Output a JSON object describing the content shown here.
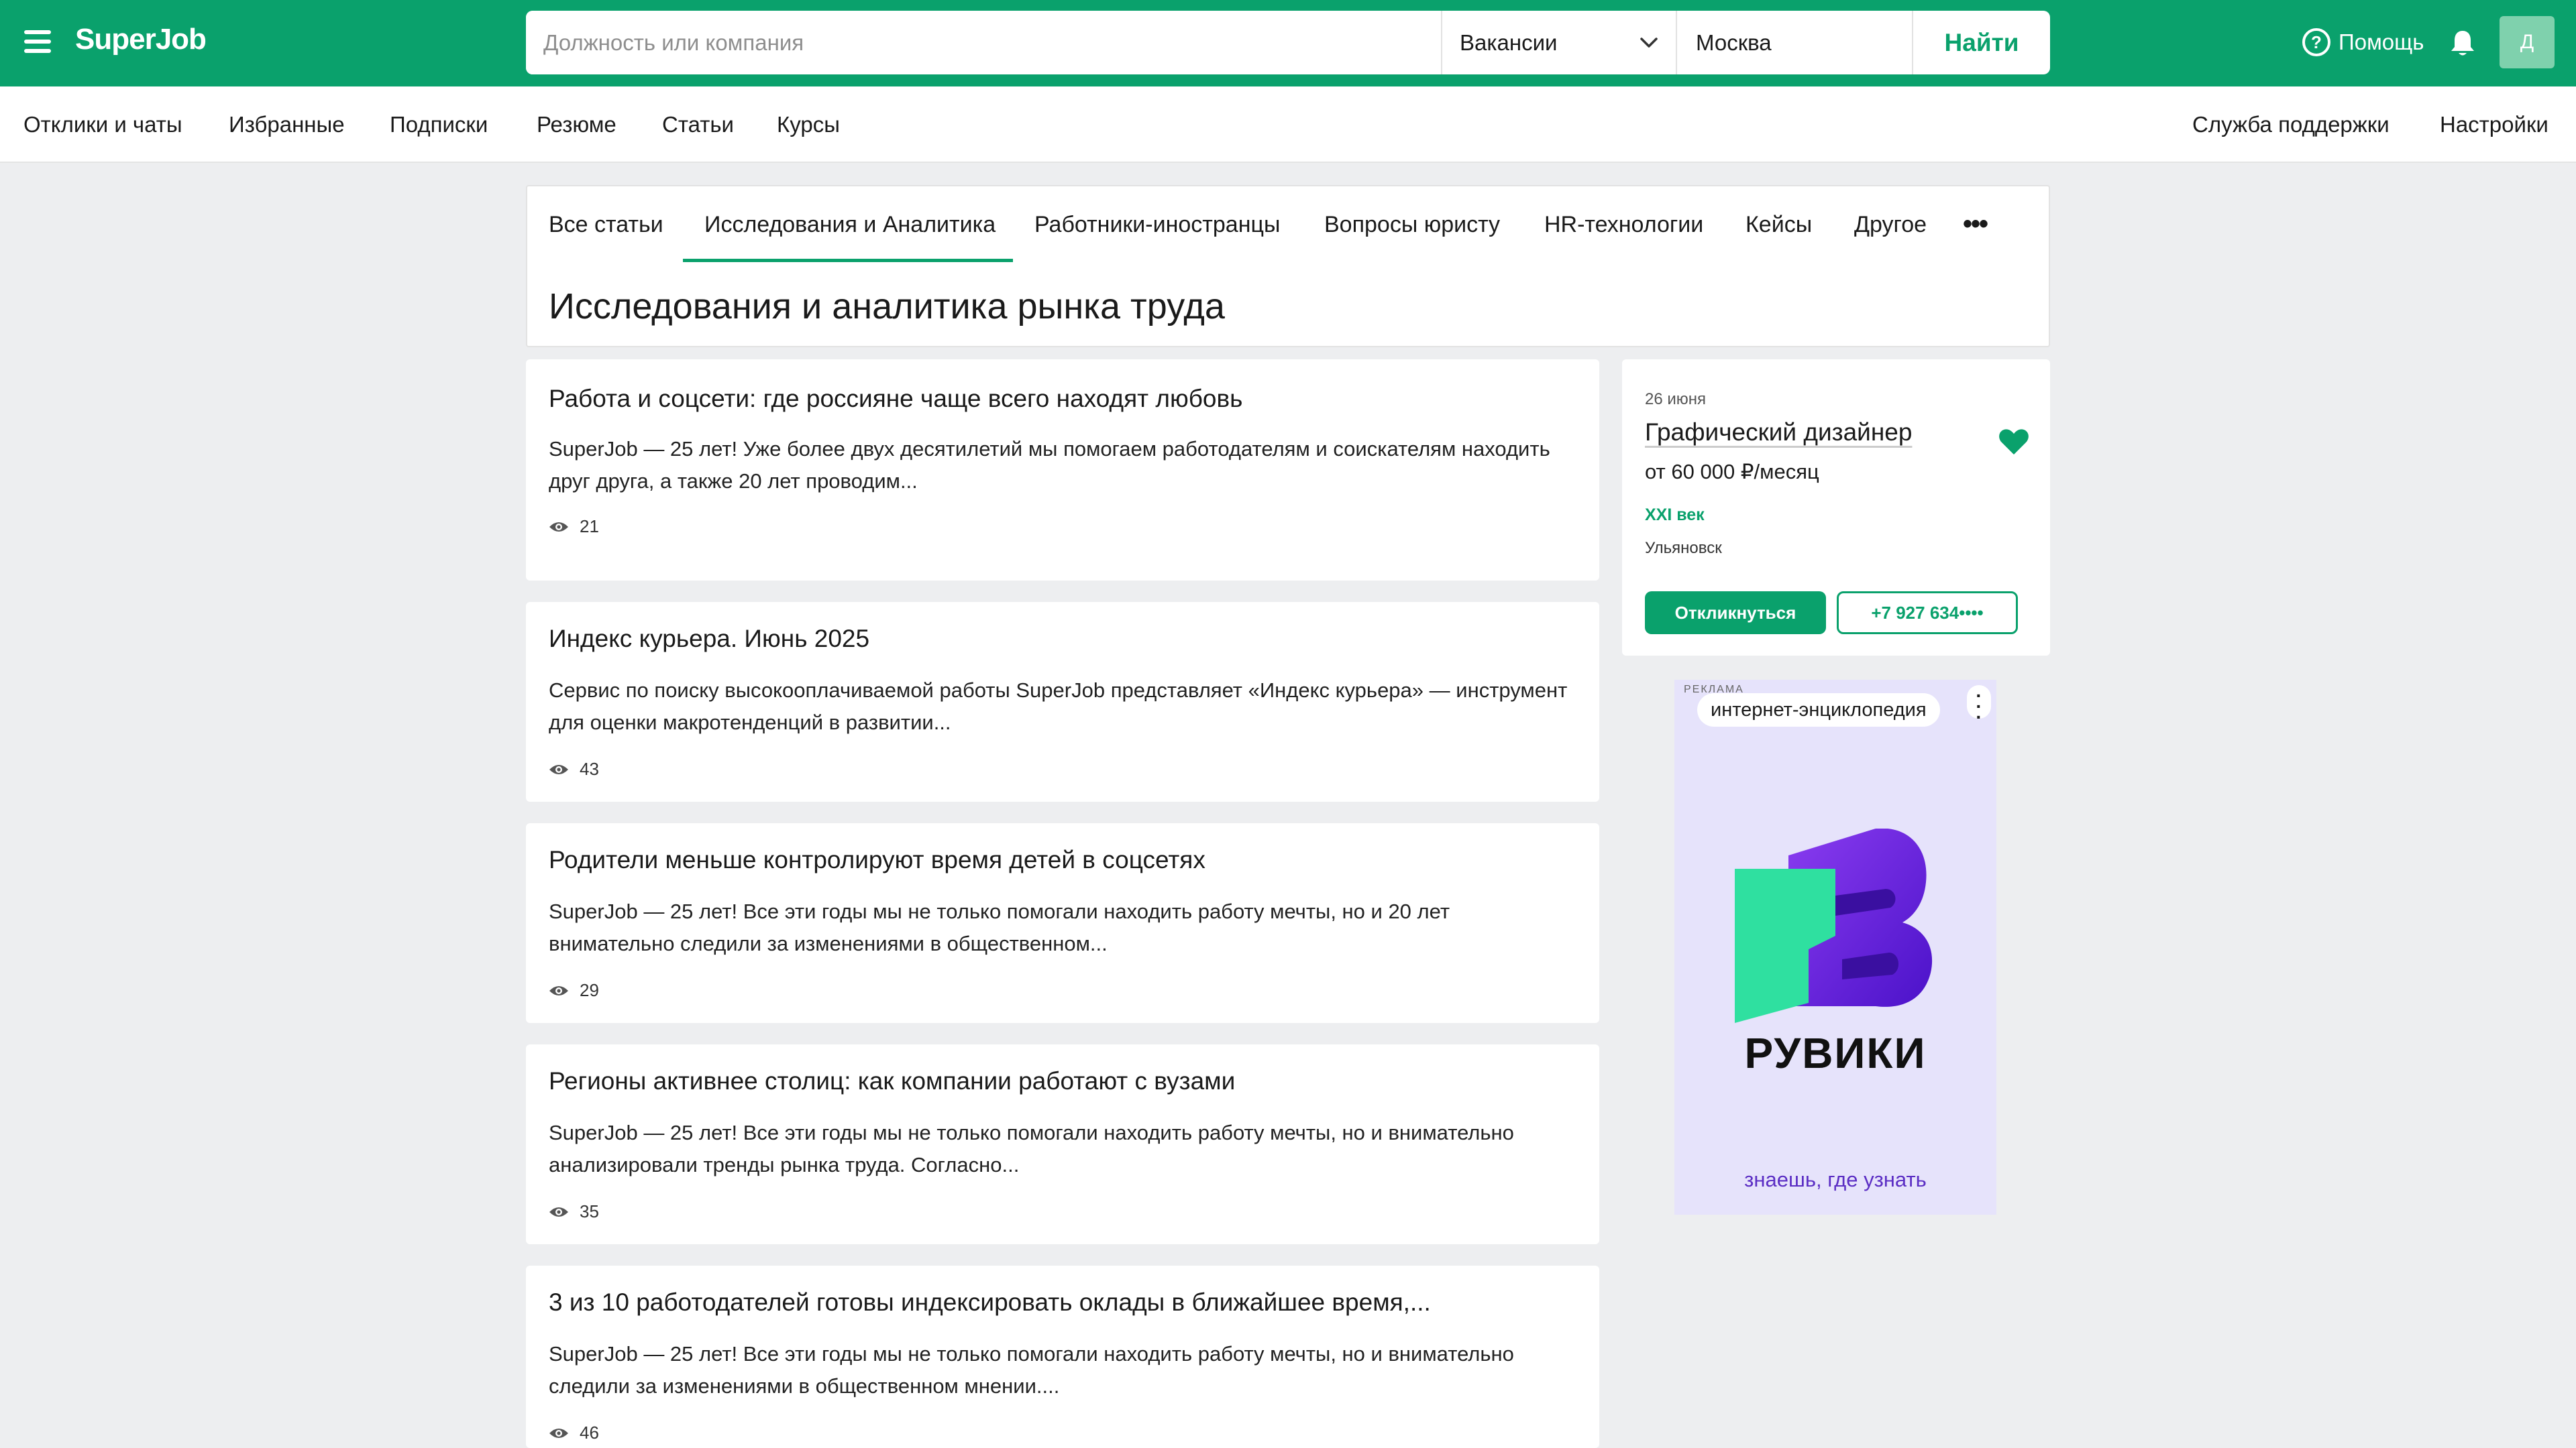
{
  "header": {
    "logo": "SuperJob",
    "search_placeholder": "Должность или компания",
    "search_type": "Вакансии",
    "city": "Москва",
    "find_label": "Найти",
    "help_label": "Помощь",
    "avatar_letter": "Д"
  },
  "subnav": {
    "items": [
      "Отклики и чаты",
      "Избранные",
      "Подписки",
      "Резюме",
      "Статьи",
      "Курсы"
    ],
    "support": "Служба поддержки",
    "settings": "Настройки"
  },
  "tabs": {
    "items": [
      "Все статьи",
      "Исследования и Аналитика",
      "Работники-иностранцы",
      "Вопросы юристу",
      "HR-технологии",
      "Кейсы",
      "Другое"
    ],
    "active_index": 1,
    "more": "•••"
  },
  "page_title": "Исследования и аналитика рынка труда",
  "articles": [
    {
      "title": "Работа и соцсети: где россияне чаще всего находят любовь",
      "excerpt": "SuperJob — 25 лет! Уже более двух десятилетий мы помогаем работодателям и соискателям находить друг друга, а также 20 лет проводим...",
      "views": "21"
    },
    {
      "title": "Индекс курьера. Июнь 2025",
      "excerpt": "Сервис по поиску высокооплачиваемой работы SuperJob представляет «Индекс курьера» — инструмент для оценки макротенденций в развитии...",
      "views": "43"
    },
    {
      "title": "Родители меньше контролируют время детей в соцсетях",
      "excerpt": "SuperJob — 25 лет! Все эти годы мы не только помогали находить работу мечты, но и 20 лет внимательно следили за изменениями в общественном...",
      "views": "29"
    },
    {
      "title": "Регионы активнее столиц: как компании работают с вузами",
      "excerpt": "SuperJob — 25 лет! Все эти годы мы не только помогали находить работу мечты, но и внимательно анализировали тренды рынка труда. Согласно...",
      "views": "35"
    },
    {
      "title": "3 из 10 работодателей готовы индексировать оклады в ближайшее время,...",
      "excerpt": "SuperJob — 25 лет! Все эти годы мы не только помогали находить работу мечты, но и внимательно следили за изменениями в общественном мнении....",
      "views": "46"
    }
  ],
  "vacancy": {
    "date": "26 июня",
    "title": "Графический дизайнер",
    "salary": "от 60 000 ₽/месяц",
    "company": "XXI век",
    "city": "Ульяновск",
    "apply_label": "Откликнуться",
    "phone_label": "+7 927 634••••"
  },
  "ad": {
    "label": "РЕКЛАМА",
    "chip": "интернет-энциклопедия",
    "brand": "РУВИКИ",
    "tagline": "знаешь, где узнать"
  },
  "colors": {
    "brand_green": "#0aa16c",
    "ad_bg": "#e6e3fb",
    "ad_purple": "#6a2ee0",
    "ad_green": "#2fe0a0"
  }
}
